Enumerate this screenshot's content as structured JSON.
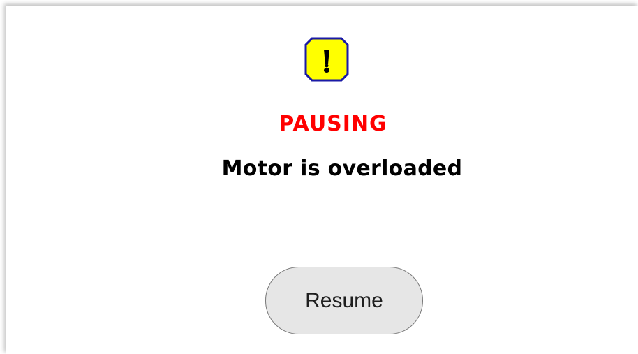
{
  "dialog": {
    "icon": "warning-exclamation-icon",
    "title": "PAUSING",
    "message": "Motor is overloaded",
    "resume_label": "Resume"
  },
  "colors": {
    "title": "#ff0000",
    "message": "#000000",
    "icon_fill": "#ffff00",
    "icon_border": "#1a1aa6",
    "button_fill": "#e6e6e6",
    "button_border": "#7a7a7a"
  }
}
